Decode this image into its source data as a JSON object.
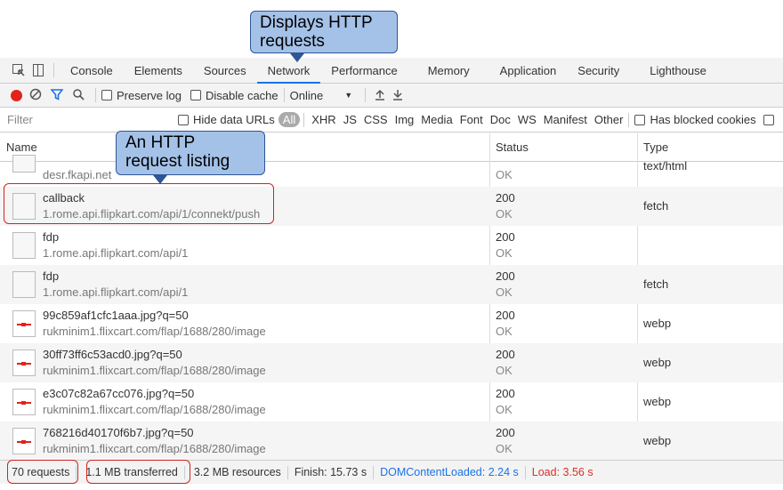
{
  "annotations": {
    "network_callout": "Displays HTTP requests",
    "listing_callout": "An HTTP request listing"
  },
  "tabs": [
    "Console",
    "Elements",
    "Sources",
    "Network",
    "Performance",
    "Memory",
    "Application",
    "Security",
    "Lighthouse"
  ],
  "active_tab": "Network",
  "toolbar": {
    "preserve_log": "Preserve log",
    "disable_cache": "Disable cache",
    "throttle": "Online"
  },
  "filterbar": {
    "placeholder": "Filter",
    "hide_data_urls": "Hide data URLs",
    "types": [
      "All",
      "XHR",
      "JS",
      "CSS",
      "Img",
      "Media",
      "Font",
      "Doc",
      "WS",
      "Manifest",
      "Other"
    ],
    "has_blocked_cookies": "Has blocked cookies"
  },
  "columns": {
    "name": "Name",
    "status": "Status",
    "type": "Type"
  },
  "requests": [
    {
      "name": "",
      "domain": "desr.fkapi.net",
      "status": "",
      "status_text": "OK",
      "type": "text/html",
      "icon": "file-icon"
    },
    {
      "name": "callback",
      "domain": "1.rome.api.flipkart.com/api/1/connekt/push",
      "status": "200",
      "status_text": "OK",
      "type": "fetch",
      "icon": "file-icon"
    },
    {
      "name": "fdp",
      "domain": "1.rome.api.flipkart.com/api/1",
      "status": "200",
      "status_text": "OK",
      "type": "",
      "icon": "file-icon"
    },
    {
      "name": "fdp",
      "domain": "1.rome.api.flipkart.com/api/1",
      "status": "200",
      "status_text": "OK",
      "type": "fetch",
      "icon": "file-icon"
    },
    {
      "name": "99c859af1cfc1aaa.jpg?q=50",
      "domain": "rukminim1.flixcart.com/flap/1688/280/image",
      "status": "200",
      "status_text": "OK",
      "type": "webp",
      "icon": "image-icon"
    },
    {
      "name": "30ff73ff6c53acd0.jpg?q=50",
      "domain": "rukminim1.flixcart.com/flap/1688/280/image",
      "status": "200",
      "status_text": "OK",
      "type": "webp",
      "icon": "image-icon"
    },
    {
      "name": "e3c07c82a67cc076.jpg?q=50",
      "domain": "rukminim1.flixcart.com/flap/1688/280/image",
      "status": "200",
      "status_text": "OK",
      "type": "webp",
      "icon": "image-icon"
    },
    {
      "name": "768216d40170f6b7.jpg?q=50",
      "domain": "rukminim1.flixcart.com/flap/1688/280/image",
      "status": "200",
      "status_text": "OK",
      "type": "webp",
      "icon": "image-icon"
    }
  ],
  "statusbar": {
    "requests": "70 requests",
    "transferred": "1.1 MB transferred",
    "resources": "3.2 MB resources",
    "finish": "Finish: 15.73 s",
    "dom_content_loaded": "DOMContentLoaded: 2.24 s",
    "load": "Load: 3.56 s"
  },
  "colors": {
    "accent": "#1a73e8",
    "record": "#e2231a",
    "callout": "#a4c2e8",
    "highlight": "#d32222"
  }
}
